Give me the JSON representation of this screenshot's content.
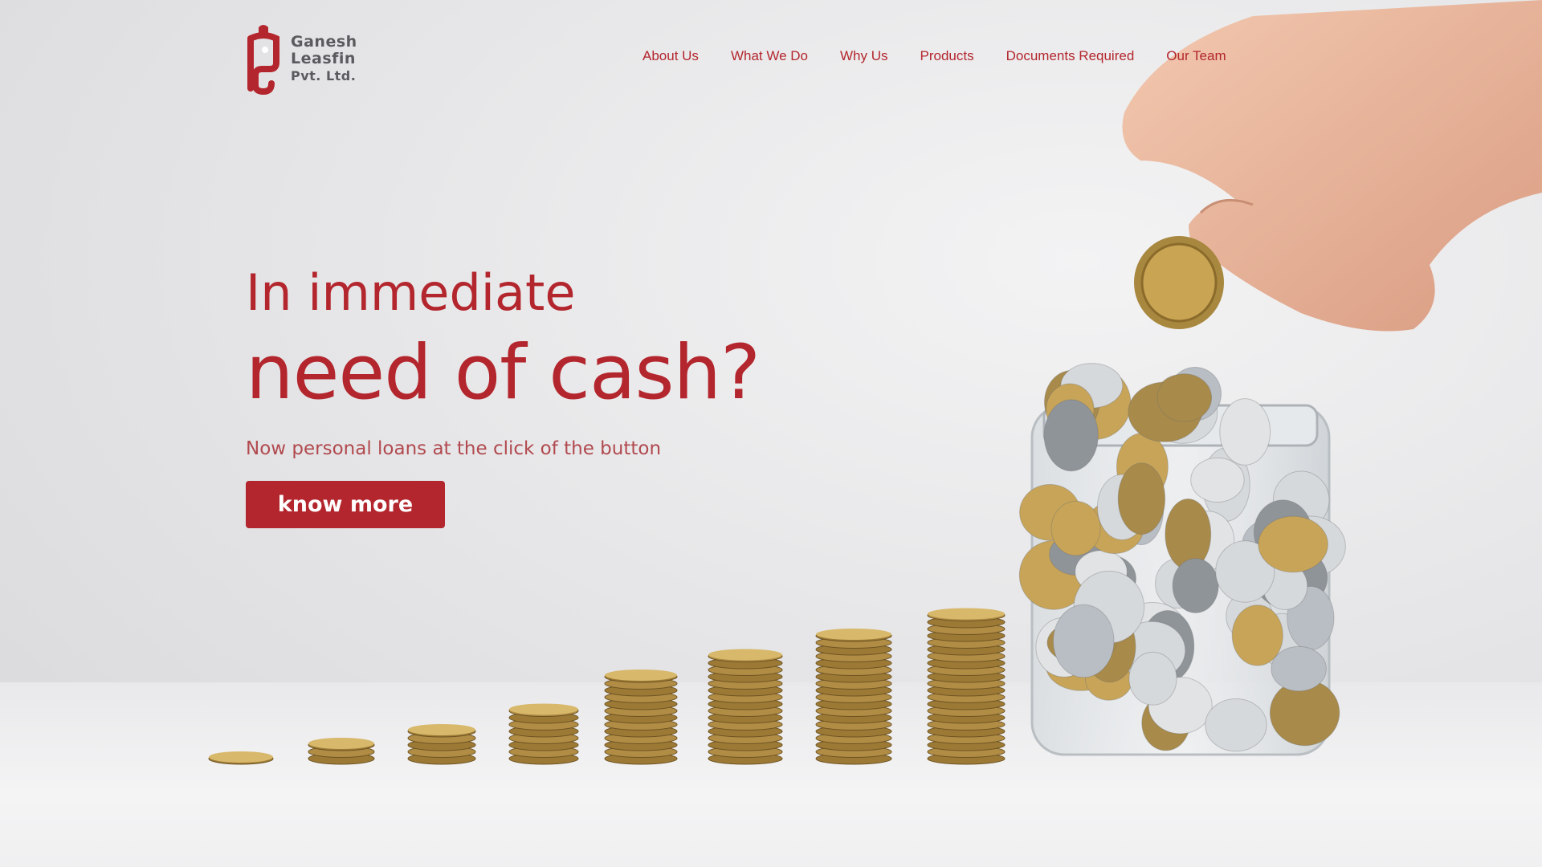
{
  "brand": {
    "name_line1": "Ganesh",
    "name_line2": "Leasfin",
    "name_line3": "Pvt. Ltd.",
    "color": "#b3262d"
  },
  "nav": {
    "items": [
      {
        "label": "About Us"
      },
      {
        "label": "What We Do"
      },
      {
        "label": "Why Us"
      },
      {
        "label": "Products"
      },
      {
        "label": "Documents Required"
      },
      {
        "label": "Our Team"
      }
    ]
  },
  "hero": {
    "headline_line1": "In immediate",
    "headline_line2": "need of cash?",
    "subtitle": "Now personal loans at the click of the button",
    "cta_label": "know more"
  },
  "image": {
    "subject": "hand-dropping-coin-into-jar-with-coin-stacks-icon"
  }
}
